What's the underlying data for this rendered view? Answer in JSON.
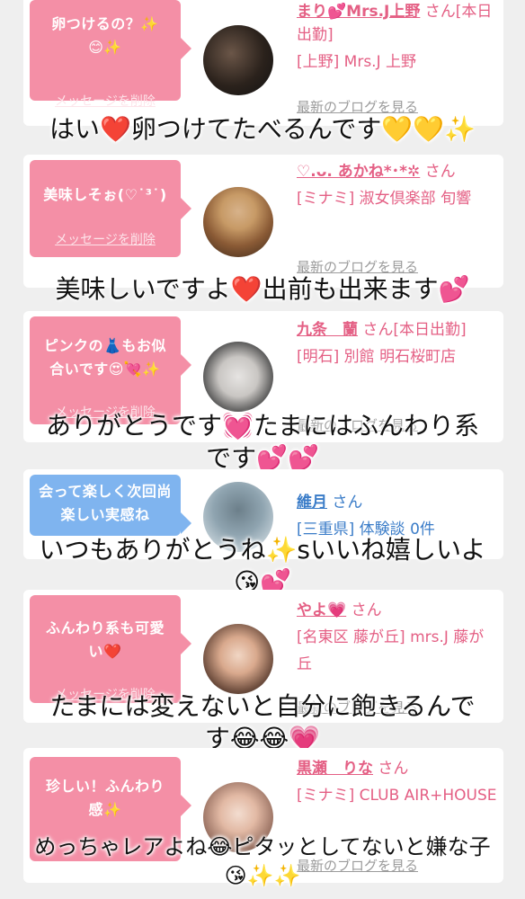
{
  "cards": [
    {
      "bubble": "卵つけるの？✨\n😊✨",
      "delete": "メッセージを削除",
      "name": "まり💕Mrs.J上野",
      "san": "さん[本日出勤]",
      "area": "[上野] Mrs.J 上野",
      "blog": "最新のブログを見る",
      "caption": "はい❤️卵つけてたべるんです💛💛✨"
    },
    {
      "bubble": "美味しそぉ(♡˙³˙)",
      "delete": "メッセージを削除",
      "name": "♡.ᴗ. あかね*･*✲",
      "san": "さん",
      "area": "[ミナミ] 淑女倶楽部 旬響",
      "blog": "最新のブログを見る",
      "caption": "美味しいですよ❤️出前も出来ます💕"
    },
    {
      "bubble": "ピンクの👗もお似合いです😍💘✨",
      "delete": "メッセージを削除",
      "name": "九条　蘭",
      "san": "さん[本日出勤]",
      "area": "[明石] 別館 明石桜町店",
      "blog": "最新のブログを見る",
      "caption": "ありがとうです💓たまにはふんわり系\nです💕💕"
    },
    {
      "bubble": "会って楽しく次回尚楽しい実感ね",
      "delete": "",
      "name": "維月",
      "san": "さん",
      "area": "[三重県] 体験談 0件",
      "blog": "",
      "caption": "いつもありがとうね✨sいいね嬉しいよ\n😘💕"
    },
    {
      "bubble": "ふんわり系も可愛い❤️",
      "delete": "メッセージを削除",
      "name": "やよ💗",
      "san": "さん",
      "area": "[名東区 藤が丘] mrs.J 藤が丘",
      "blog": "最新のブログを見る",
      "caption": "たまには変えないと自分に飽きるんで\nす😂😂💗"
    },
    {
      "bubble": "珍しい！ふんわり感✨",
      "delete": "メッセージを削除",
      "name": "黒瀬　りな",
      "san": "さん",
      "area": "[ミナミ] CLUB AIR+HOUSE",
      "blog": "最新のブログを見る",
      "caption": "めっちゃレアよね😂ピタッとしてないと嫌な子\n😘✨✨"
    }
  ],
  "colors": {
    "accent_pink": "#f48fa6",
    "accent_blue": "#7fb4ef",
    "name_pink": "#e45f84",
    "link_gray": "#9b9b9b"
  }
}
